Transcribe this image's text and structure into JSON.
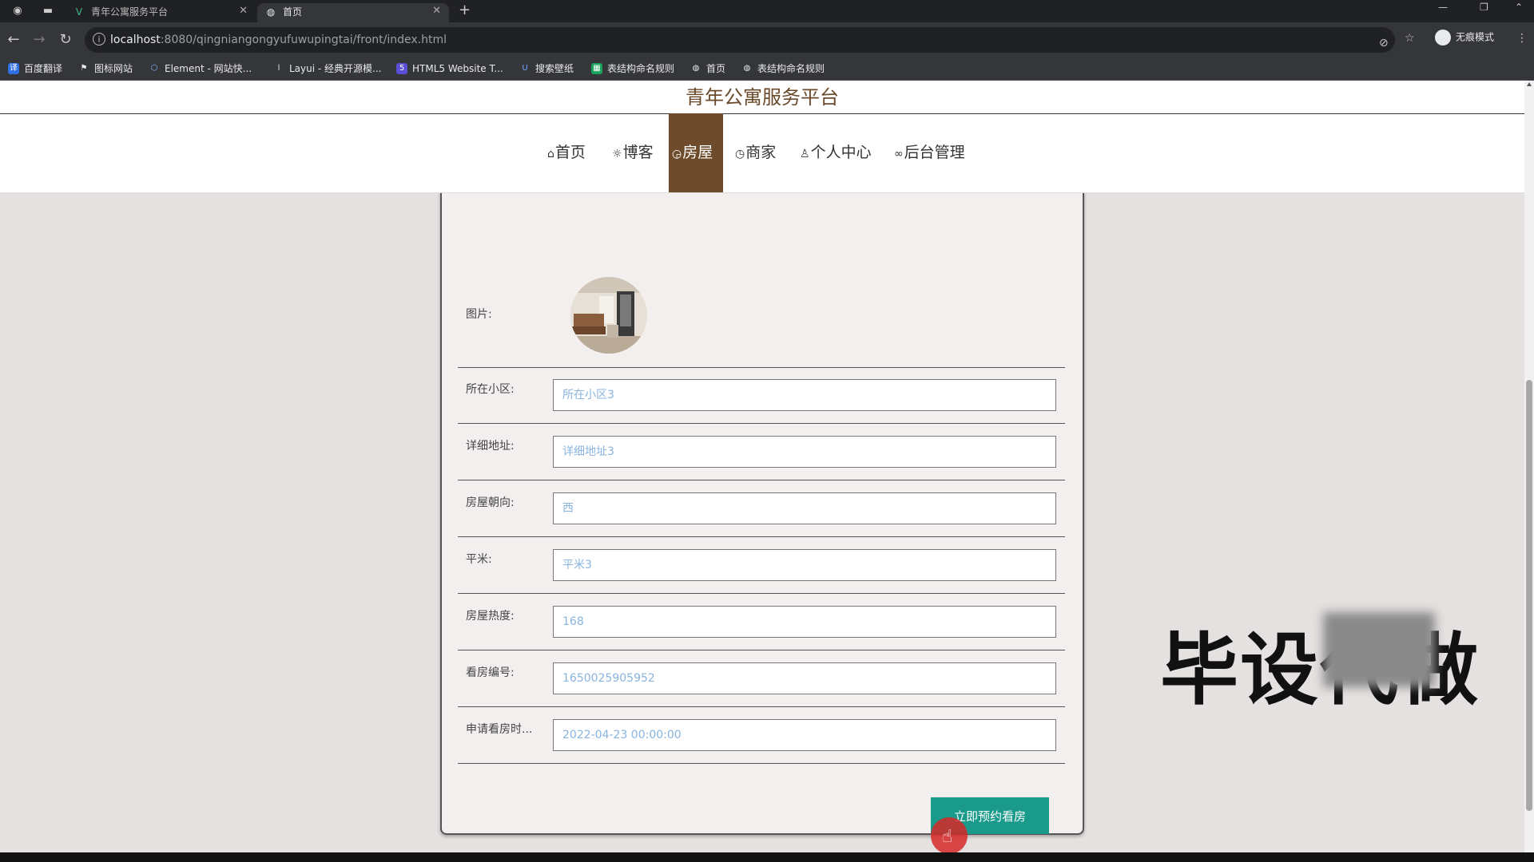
{
  "browser": {
    "tabs": [
      {
        "title": "青年公寓服务平台",
        "active": false
      },
      {
        "title": "首页",
        "active": true
      }
    ],
    "url_host": "localhost",
    "url_path": ":8080/qingniangongyufuwupingtai/front/index.html",
    "profile_label": "无痕模式",
    "bookmarks": [
      {
        "label": "百度翻译",
        "icon": "translate-icon",
        "color": "#2f6fe4"
      },
      {
        "label": "图标网站",
        "icon": "flag-icon",
        "color": "#444"
      },
      {
        "label": "Element - 网站快...",
        "icon": "element-icon",
        "color": "#409eff"
      },
      {
        "label": "Layui - 经典开源模...",
        "icon": "layui-icon",
        "color": "#444"
      },
      {
        "label": "HTML5 Website T...",
        "icon": "html5-icon",
        "color": "#5b4fd6"
      },
      {
        "label": "搜索壁纸",
        "icon": "wallpaper-icon",
        "color": "#2b63c7"
      },
      {
        "label": "表结构命名规则",
        "icon": "sheet-icon",
        "color": "#1ba35d"
      },
      {
        "label": "首页",
        "icon": "globe-icon",
        "color": "#444"
      },
      {
        "label": "表结构命名规则",
        "icon": "globe-icon",
        "color": "#444"
      }
    ]
  },
  "site": {
    "title": "青年公寓服务平台",
    "menu": [
      {
        "label": "首页",
        "icon": "home-icon",
        "glyph": "⌂",
        "active": false
      },
      {
        "label": "博客",
        "icon": "blog-icon",
        "glyph": "☼",
        "active": false
      },
      {
        "label": "房屋",
        "icon": "house-icon",
        "glyph": "◶",
        "active": true
      },
      {
        "label": "商家",
        "icon": "shop-icon",
        "glyph": "◷",
        "active": false
      },
      {
        "label": "个人中心",
        "icon": "user-icon",
        "glyph": "♙",
        "active": false
      },
      {
        "label": "后台管理",
        "icon": "link-icon",
        "glyph": "∞",
        "active": false
      }
    ]
  },
  "form": {
    "image_label": "图片:",
    "fields": [
      {
        "label": "所在小区:",
        "placeholder": "所在小区3"
      },
      {
        "label": "详细地址:",
        "placeholder": "详细地址3"
      },
      {
        "label": "房屋朝向:",
        "placeholder": "西"
      },
      {
        "label": "平米:",
        "placeholder": "平米3"
      },
      {
        "label": "房屋热度:",
        "placeholder": "168"
      },
      {
        "label": "看房编号:",
        "placeholder": "1650025905952"
      },
      {
        "label": "申请看房时...",
        "placeholder": "2022-04-23 00:00:00"
      }
    ],
    "submit_label": "立即预约看房"
  },
  "watermark": {
    "text": "毕设代做"
  },
  "colors": {
    "accent": "#6e4b2a",
    "button": "#1a9a8a",
    "page_bg": "#e6e1e1"
  }
}
